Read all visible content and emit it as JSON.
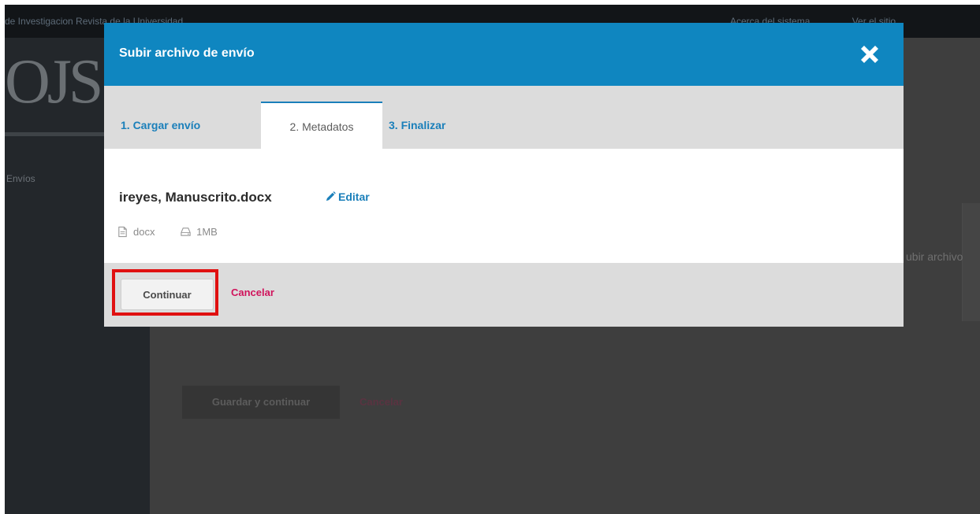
{
  "background_page": {
    "topbar_left_text": "de Investigacion Revista de la Universidad",
    "topbar_right_items": [
      "Acerca del sistema",
      "Ver el sitio"
    ],
    "logo": "OJS",
    "sidebar_item": "Envíos",
    "panel_partial_text": "ubir archivo",
    "save_button": "Guardar y continuar",
    "cancel_link": "Cancelar"
  },
  "modal": {
    "title": "Subir archivo de envío",
    "close_icon": "close-icon",
    "tabs": [
      {
        "label": "1. Cargar envío"
      },
      {
        "label": "2. Metadatos"
      },
      {
        "label": "3. Finalizar"
      }
    ],
    "active_tab": 1,
    "file": {
      "name": "ireyes, Manuscrito.docx",
      "edit_label": "Editar",
      "type": "docx",
      "size": "1MB"
    },
    "footer": {
      "continue_label": "Continuar",
      "cancel_label": "Cancelar"
    }
  },
  "colors": {
    "header": "#0f86c0",
    "link": "#1a7fba",
    "cancel": "#d0135b",
    "highlight": "#e01010"
  }
}
